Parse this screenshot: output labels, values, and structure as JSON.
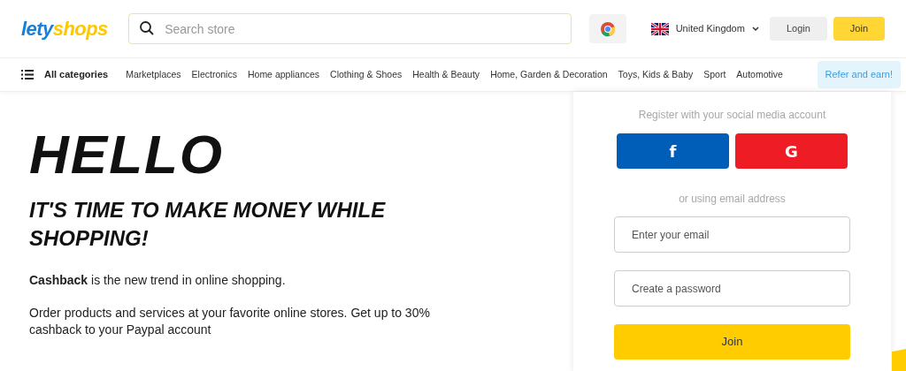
{
  "logo": {
    "part_1": "lety",
    "part_2": "shops"
  },
  "search": {
    "placeholder": "Search store"
  },
  "country": {
    "label": "United Kingdom"
  },
  "header_buttons": [
    {
      "label": "Login",
      "kind": "secondary"
    },
    {
      "label": "Join",
      "kind": "primary"
    }
  ],
  "nav": {
    "all_categories": "All categories",
    "items": [
      "Marketplaces",
      "Electronics",
      "Home appliances",
      "Clothing & Shoes",
      "Health & Beauty",
      "Home, Garden & Decoration",
      "Toys, Kids & Baby",
      "Sport",
      "Automotive"
    ],
    "promo": "Refer and earn!"
  },
  "hero": {
    "title": "HELLO",
    "subtitle": "IT'S TIME TO MAKE MONEY WHILE SHOPPING!",
    "paragraphs": [
      "**Cashback** is the new trend in online shopping.",
      "Order products and services at your favorite online stores. Get up to 30% cashback to your Paypal account"
    ]
  },
  "register": {
    "social_caption": "Register with your social media account",
    "social_buttons": [
      {
        "label": "f",
        "kind": "facebook"
      },
      {
        "label": "G",
        "kind": "google"
      }
    ],
    "email_caption": "or using email address",
    "fields": [
      {
        "placeholder": "Enter your email"
      },
      {
        "placeholder": "Create a password"
      }
    ],
    "submit": "Join"
  }
}
